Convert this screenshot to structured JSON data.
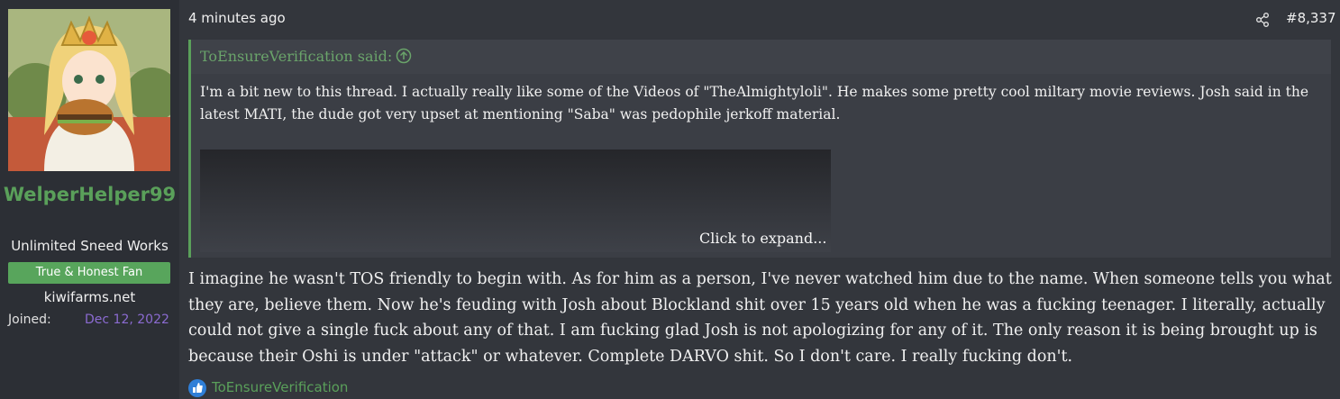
{
  "post": {
    "timestamp": "4 minutes ago",
    "number": "#8,337",
    "author": {
      "username": "WelperHelper99",
      "title": "Unlimited Sneed Works",
      "banner": "True & Honest Fan",
      "site": "kiwifarms.net",
      "joined_label": "Joined:",
      "joined_value": "Dec 12, 2022"
    },
    "quote": {
      "author": "ToEnsureVerification said:",
      "text": "I'm a bit new to this thread. I actually really like some of the Videos of \"TheAlmightyloli\". He makes some pretty cool miltary movie reviews. Josh said in the latest MATI, the dude got very upset at mentioning \"Saba\" was pedophile jerkoff material.",
      "expand_label": "Click to expand..."
    },
    "body": "I imagine he wasn't TOS friendly to begin with. As for him as a person, I've never watched him due to the name. When someone tells you what they are, believe them. Now he's feuding with Josh about Blockland shit over 15 years old when he was a fucking teenager. I literally, actually could not give a single fuck about any of that. I am fucking glad Josh is not apologizing for any of it. The only reason it is being brought up is because their Oshi is under \"attack\" or whatever. Complete DARVO shit. So I don't care. I really fucking don't.",
    "reaction": {
      "icon": "thumbs-up-icon",
      "user": "ToEnsureVerification"
    }
  },
  "colors": {
    "accent": "#5aa05a",
    "joined_date": "#8b6bd1",
    "background": "#33363c",
    "sidebar": "#2c2f35"
  }
}
